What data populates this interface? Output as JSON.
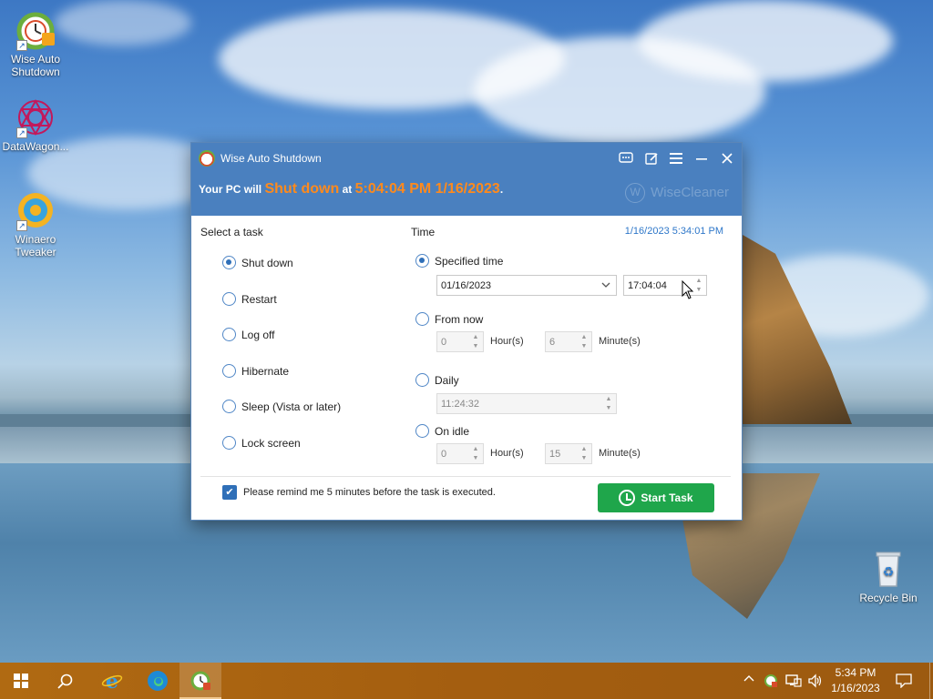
{
  "desktop": {
    "icons": [
      {
        "label_line1": "Wise Auto",
        "label_line2": "Shutdown"
      },
      {
        "label_line1": "DataWagon...",
        "label_line2": ""
      },
      {
        "label_line1": "Winaero",
        "label_line2": "Tweaker"
      },
      {
        "label_line1": "Recycle Bin",
        "label_line2": ""
      }
    ]
  },
  "app": {
    "title": "Wise Auto Shutdown",
    "status": {
      "prefix": "Your PC will",
      "action": "Shut down",
      "at": "at",
      "when": "5:04:04 PM 1/16/2023",
      "suffix": "."
    },
    "brand": "WiseCleaner",
    "brand_letter": "W",
    "select_task_label": "Select a task",
    "time_label": "Time",
    "current_time": "1/16/2023 5:34:01 PM",
    "tasks": [
      {
        "label": "Shut down",
        "checked": true
      },
      {
        "label": "Restart",
        "checked": false
      },
      {
        "label": "Log off",
        "checked": false
      },
      {
        "label": "Hibernate",
        "checked": false
      },
      {
        "label": "Sleep (Vista or later)",
        "checked": false
      },
      {
        "label": "Lock screen",
        "checked": false
      }
    ],
    "time_modes": {
      "specified": {
        "label": "Specified time",
        "checked": true,
        "date": "01/16/2023",
        "time": "17:04:04"
      },
      "from_now": {
        "label": "From now",
        "checked": false,
        "hours": "0",
        "hours_unit": "Hour(s)",
        "minutes": "6",
        "minutes_unit": "Minute(s)"
      },
      "daily": {
        "label": "Daily",
        "checked": false,
        "time": "11:24:32"
      },
      "on_idle": {
        "label": "On idle",
        "checked": false,
        "hours": "0",
        "hours_unit": "Hour(s)",
        "minutes": "15",
        "minutes_unit": "Minute(s)"
      }
    },
    "remind": {
      "checked": true,
      "label": "Please remind me 5 minutes before the task is executed."
    },
    "start_button": "Start Task"
  },
  "taskbar": {
    "clock_time": "5:34 PM",
    "clock_date": "1/16/2023"
  },
  "colors": {
    "header": "#4a80bf",
    "accent_orange": "#ff8a1c",
    "start_green": "#1fa64b",
    "taskbar": "#a45e10"
  }
}
